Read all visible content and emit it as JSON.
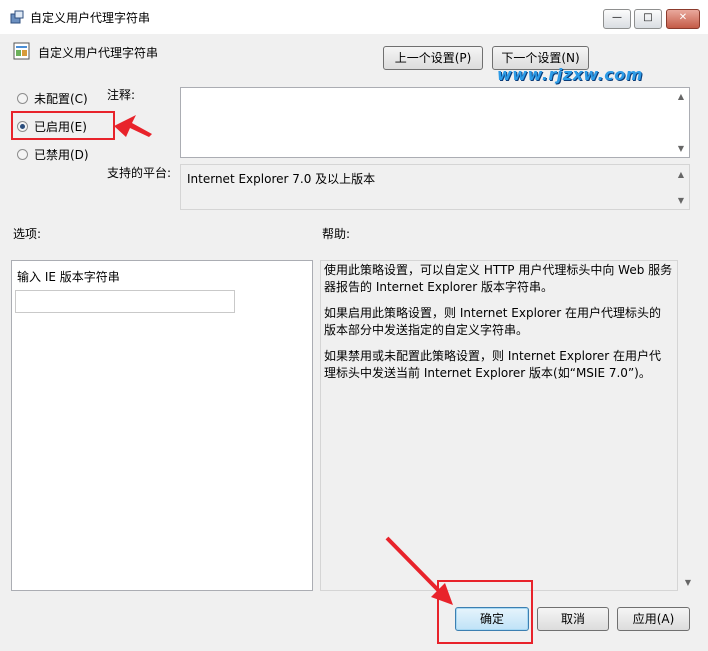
{
  "window": {
    "title": "自定义用户代理字符串",
    "min": "—",
    "max": "□",
    "close": "✕"
  },
  "header": {
    "policy_name": "自定义用户代理字符串",
    "prev_button": "上一个设置(P)",
    "next_button": "下一个设置(N)"
  },
  "watermark": "www.rjzxw.com",
  "state": {
    "options": [
      {
        "label": "未配置(C)",
        "selected": false
      },
      {
        "label": "已启用(E)",
        "selected": true
      },
      {
        "label": "已禁用(D)",
        "selected": false
      }
    ]
  },
  "comment": {
    "label": "注释:",
    "value": ""
  },
  "platform": {
    "label": "支持的平台:",
    "value": "Internet Explorer 7.0 及以上版本"
  },
  "options_panel": {
    "label": "选项:",
    "field_label": "输入 IE 版本字符串",
    "field_value": ""
  },
  "help_panel": {
    "label": "帮助:",
    "paragraphs": [
      "使用此策略设置，可以自定义 HTTP 用户代理标头中向 Web 服务器报告的 Internet Explorer 版本字符串。",
      "如果启用此策略设置，则 Internet Explorer 在用户代理标头的版本部分中发送指定的自定义字符串。",
      "如果禁用或未配置此策略设置，则 Internet Explorer 在用户代理标头中发送当前 Internet Explorer 版本(如“MSIE 7.0”)。"
    ]
  },
  "footer": {
    "ok": "确定",
    "cancel": "取消",
    "apply": "应用(A)"
  },
  "colors": {
    "annotation": "#e8232b",
    "watermark": "#2d9be6"
  },
  "icons": {
    "window": "policy-icon",
    "header": "settings-doc-icon"
  }
}
